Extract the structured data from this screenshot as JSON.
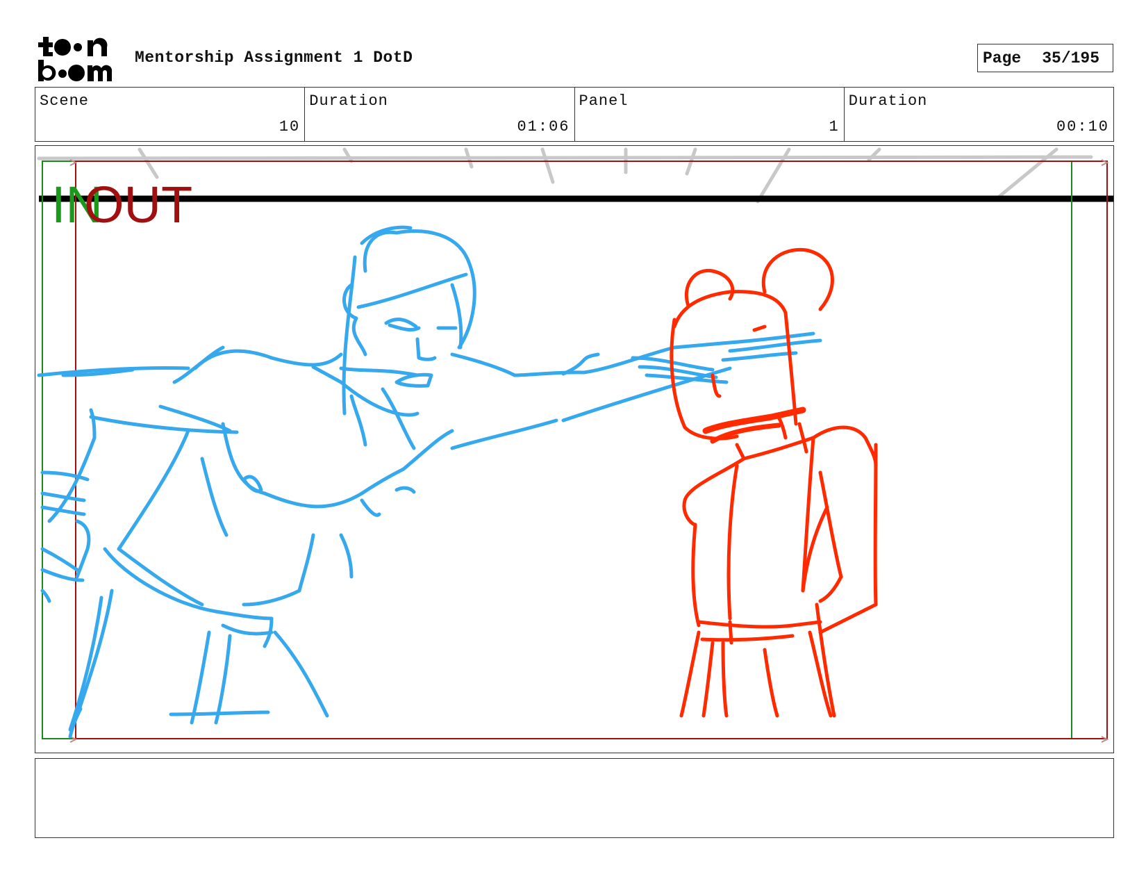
{
  "header": {
    "logo_text": "toonboom",
    "project_title": "Mentorship Assignment 1 DotD",
    "page_label": "Page",
    "page_value": "35/195"
  },
  "info": {
    "scene_label": "Scene",
    "scene_value": "10",
    "scene_duration_label": "Duration",
    "scene_duration_value": "01:06",
    "panel_label": "Panel",
    "panel_value": "1",
    "panel_duration_label": "Duration",
    "panel_duration_value": "00:10"
  },
  "panel": {
    "in_label": "IN",
    "out_label": "OUT",
    "colors": {
      "in_frame": "#1a8a1a",
      "out_frame": "#a01010",
      "left_character": "#36a9ee",
      "right_character": "#ff2a00",
      "horizon": "#000000",
      "background_lines": "#c8c8c8"
    }
  },
  "caption": {
    "text": ""
  }
}
